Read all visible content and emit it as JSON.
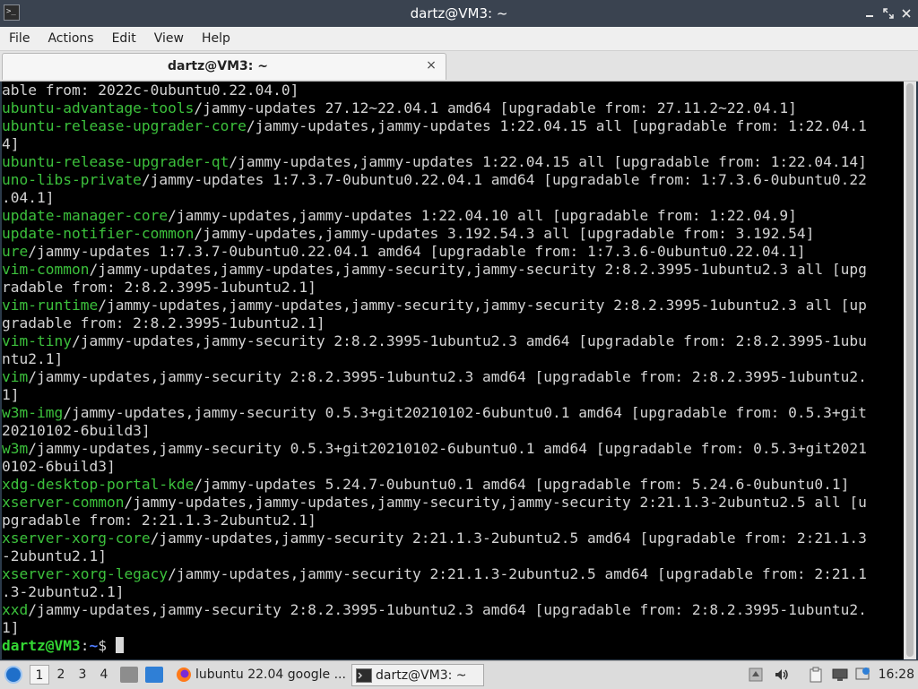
{
  "window": {
    "title": "dartz@VM3: ~"
  },
  "menu": [
    "File",
    "Actions",
    "Edit",
    "View",
    "Help"
  ],
  "tab": {
    "label": "dartz@VM3: ~",
    "close_glyph": "×"
  },
  "terminal": {
    "lines": [
      {
        "pkg": "",
        "rest": "able from: 2022c-0ubuntu0.22.04.0]"
      },
      {
        "pkg": "ubuntu-advantage-tools",
        "rest": "/jammy-updates 27.12~22.04.1 amd64 [upgradable from: 27.11.2~22.04.1]"
      },
      {
        "pkg": "ubuntu-release-upgrader-core",
        "rest": "/jammy-updates,jammy-updates 1:22.04.15 all [upgradable from: 1:22.04.1"
      },
      {
        "pkg": "",
        "rest": "4]"
      },
      {
        "pkg": "ubuntu-release-upgrader-qt",
        "rest": "/jammy-updates,jammy-updates 1:22.04.15 all [upgradable from: 1:22.04.14]"
      },
      {
        "pkg": "uno-libs-private",
        "rest": "/jammy-updates 1:7.3.7-0ubuntu0.22.04.1 amd64 [upgradable from: 1:7.3.6-0ubuntu0.22"
      },
      {
        "pkg": "",
        "rest": ".04.1]"
      },
      {
        "pkg": "update-manager-core",
        "rest": "/jammy-updates,jammy-updates 1:22.04.10 all [upgradable from: 1:22.04.9]"
      },
      {
        "pkg": "update-notifier-common",
        "rest": "/jammy-updates,jammy-updates 3.192.54.3 all [upgradable from: 3.192.54]"
      },
      {
        "pkg": "ure",
        "rest": "/jammy-updates 1:7.3.7-0ubuntu0.22.04.1 amd64 [upgradable from: 1:7.3.6-0ubuntu0.22.04.1]"
      },
      {
        "pkg": "vim-common",
        "rest": "/jammy-updates,jammy-updates,jammy-security,jammy-security 2:8.2.3995-1ubuntu2.3 all [upg"
      },
      {
        "pkg": "",
        "rest": "radable from: 2:8.2.3995-1ubuntu2.1]"
      },
      {
        "pkg": "vim-runtime",
        "rest": "/jammy-updates,jammy-updates,jammy-security,jammy-security 2:8.2.3995-1ubuntu2.3 all [up"
      },
      {
        "pkg": "",
        "rest": "gradable from: 2:8.2.3995-1ubuntu2.1]"
      },
      {
        "pkg": "vim-tiny",
        "rest": "/jammy-updates,jammy-security 2:8.2.3995-1ubuntu2.3 amd64 [upgradable from: 2:8.2.3995-1ubu"
      },
      {
        "pkg": "",
        "rest": "ntu2.1]"
      },
      {
        "pkg": "vim",
        "rest": "/jammy-updates,jammy-security 2:8.2.3995-1ubuntu2.3 amd64 [upgradable from: 2:8.2.3995-1ubuntu2."
      },
      {
        "pkg": "",
        "rest": "1]"
      },
      {
        "pkg": "w3m-img",
        "rest": "/jammy-updates,jammy-security 0.5.3+git20210102-6ubuntu0.1 amd64 [upgradable from: 0.5.3+git"
      },
      {
        "pkg": "",
        "rest": "20210102-6build3]"
      },
      {
        "pkg": "w3m",
        "rest": "/jammy-updates,jammy-security 0.5.3+git20210102-6ubuntu0.1 amd64 [upgradable from: 0.5.3+git2021"
      },
      {
        "pkg": "",
        "rest": "0102-6build3]"
      },
      {
        "pkg": "xdg-desktop-portal-kde",
        "rest": "/jammy-updates 5.24.7-0ubuntu0.1 amd64 [upgradable from: 5.24.6-0ubuntu0.1]"
      },
      {
        "pkg": "xserver-common",
        "rest": "/jammy-updates,jammy-updates,jammy-security,jammy-security 2:21.1.3-2ubuntu2.5 all [u"
      },
      {
        "pkg": "",
        "rest": "pgradable from: 2:21.1.3-2ubuntu2.1]"
      },
      {
        "pkg": "xserver-xorg-core",
        "rest": "/jammy-updates,jammy-security 2:21.1.3-2ubuntu2.5 amd64 [upgradable from: 2:21.1.3"
      },
      {
        "pkg": "",
        "rest": "-2ubuntu2.1]"
      },
      {
        "pkg": "xserver-xorg-legacy",
        "rest": "/jammy-updates,jammy-security 2:21.1.3-2ubuntu2.5 amd64 [upgradable from: 2:21.1"
      },
      {
        "pkg": "",
        "rest": ".3-2ubuntu2.1]"
      },
      {
        "pkg": "xxd",
        "rest": "/jammy-updates,jammy-security 2:8.2.3995-1ubuntu2.3 amd64 [upgradable from: 2:8.2.3995-1ubuntu2."
      },
      {
        "pkg": "",
        "rest": "1]"
      }
    ],
    "prompt": {
      "user_host": "dartz@VM3",
      "sep": ":",
      "path": "~",
      "symbol": "$ "
    }
  },
  "taskbar": {
    "workspaces": [
      "1",
      "2",
      "3",
      "4"
    ],
    "tasks": [
      {
        "label": "lubuntu 22.04 google ...",
        "icon": "firefox-icon"
      },
      {
        "label": "dartz@VM3: ~",
        "icon": "terminal-icon"
      }
    ],
    "clock": "16:28"
  },
  "colors": {
    "package_name": "#3cc13c",
    "prompt_user": "#33d633",
    "prompt_path": "#4f7cff"
  }
}
